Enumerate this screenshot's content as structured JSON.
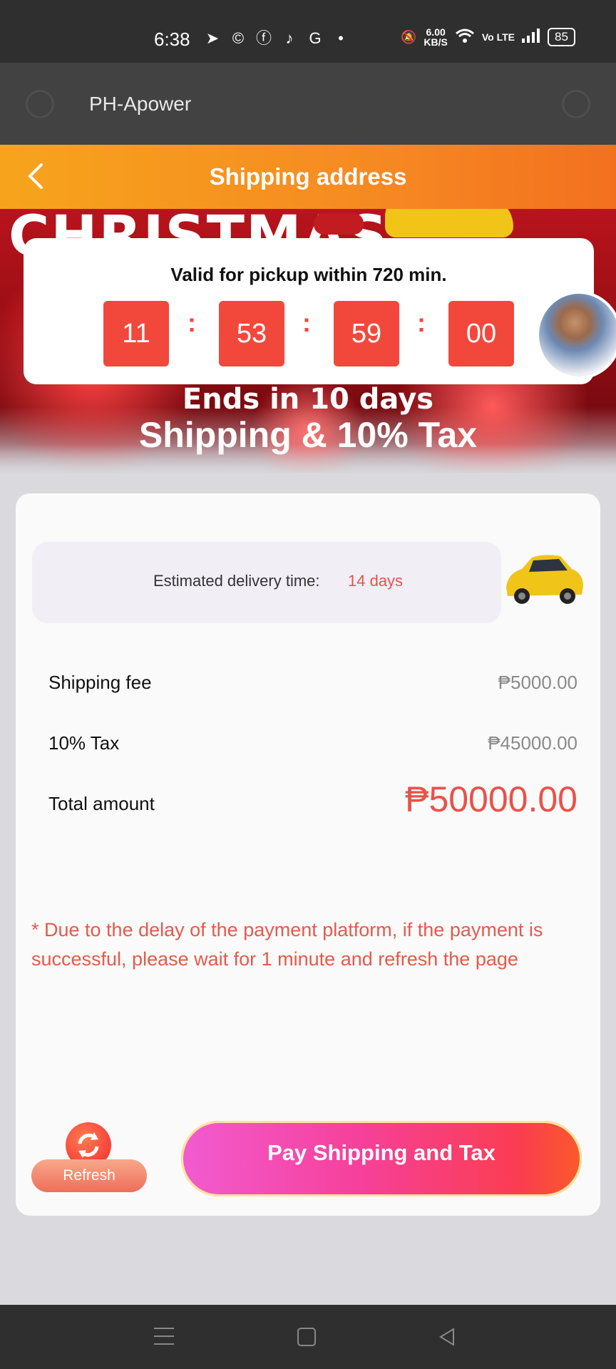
{
  "status_bar": {
    "time": "6:38",
    "speed_top": "6.00",
    "speed_bottom": "KB/S",
    "volte": "Vo LTE",
    "battery": "85"
  },
  "app_bar": {
    "title": "PH-Apower"
  },
  "header": {
    "title": "Shipping address"
  },
  "banner": {
    "headline": "CHRISTMAS",
    "ends": "Ends in 10 days",
    "subtitle": "Shipping & 10% Tax"
  },
  "timer": {
    "text": "Valid for pickup within 720 min.",
    "hours": "11",
    "minutes": "53",
    "seconds": "59",
    "centis": "00",
    "separator": ":"
  },
  "delivery": {
    "label": "Estimated delivery time:",
    "value": "14 days"
  },
  "fees": {
    "shipping_label": "Shipping fee",
    "shipping_value": "₱5000.00",
    "tax_label": "10% Tax",
    "tax_value": "₱45000.00",
    "total_label": "Total amount",
    "total_value": "₱50000.00"
  },
  "notice": "* Due to the delay of the payment platform, if the payment is successful, please wait for 1 minute and refresh the page",
  "actions": {
    "refresh_label": "Refresh",
    "pay_label": "Pay Shipping and Tax"
  },
  "colors": {
    "accent_orange": "#f68a22",
    "timer_red": "#f2483c",
    "price_red": "#e9524a"
  }
}
